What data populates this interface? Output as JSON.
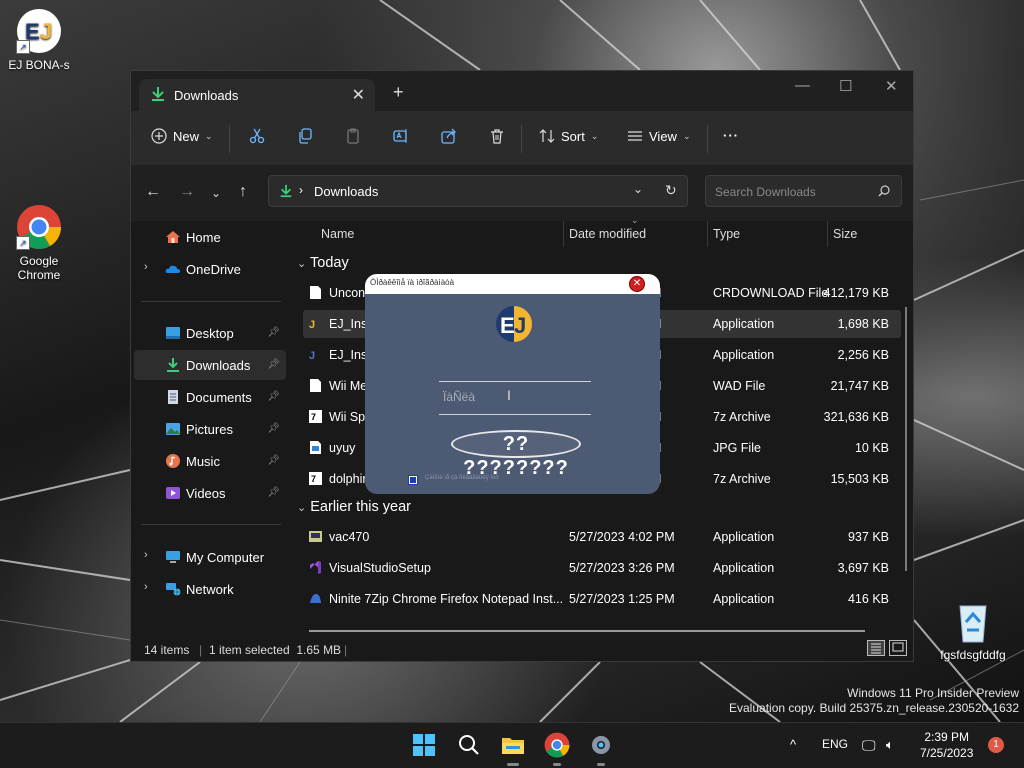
{
  "desktop": {
    "icons": [
      {
        "label": "EJ BONA-s"
      },
      {
        "label": "Google Chrome"
      },
      {
        "label": "fgsfdsgfddfg"
      }
    ]
  },
  "explorer": {
    "tab_title": "Downloads",
    "toolbar": {
      "new_label": "New",
      "sort_label": "Sort",
      "view_label": "View",
      "more_label": "···"
    },
    "breadcrumb": "Downloads",
    "search_placeholder": "Search Downloads",
    "sidebar": {
      "items": [
        {
          "label": "Home",
          "icon": "home-icon"
        },
        {
          "label": "OneDrive",
          "icon": "cloud-icon"
        },
        {
          "label": "Desktop",
          "icon": "desktop-icon"
        },
        {
          "label": "Downloads",
          "icon": "download-icon"
        },
        {
          "label": "Documents",
          "icon": "document-icon"
        },
        {
          "label": "Pictures",
          "icon": "picture-icon"
        },
        {
          "label": "Music",
          "icon": "music-icon"
        },
        {
          "label": "Videos",
          "icon": "video-icon"
        },
        {
          "label": "My Computer",
          "icon": "computer-icon"
        },
        {
          "label": "Network",
          "icon": "network-icon"
        }
      ]
    },
    "columns": {
      "name": "Name",
      "date": "Date modified",
      "type": "Type",
      "size": "Size"
    },
    "groups": {
      "today": "Today",
      "earlier": "Earlier this year"
    },
    "files_today": [
      {
        "name": "Uncon",
        "date": "M",
        "type": "CRDOWNLOAD File",
        "size": "412,179 KB"
      },
      {
        "name": "EJ_Insta",
        "date": "M",
        "type": "Application",
        "size": "1,698 KB"
      },
      {
        "name": "EJ_Insta",
        "date": "M",
        "type": "Application",
        "size": "2,256 KB"
      },
      {
        "name": "Wii Me",
        "date": "M",
        "type": "WAD File",
        "size": "21,747 KB"
      },
      {
        "name": "Wii Spo",
        "date": "M",
        "type": "7z Archive",
        "size": "321,636 KB"
      },
      {
        "name": "uyuy",
        "date": "M",
        "type": "JPG File",
        "size": "10 KB"
      },
      {
        "name": "dolphin",
        "date": "M",
        "type": "7z Archive",
        "size": "15,503 KB"
      }
    ],
    "files_earlier": [
      {
        "name": "vac470",
        "date": "5/27/2023 4:02 PM",
        "type": "Application",
        "size": "937 KB"
      },
      {
        "name": "VisualStudioSetup",
        "date": "5/27/2023 3:26 PM",
        "type": "Application",
        "size": "3,697 KB"
      },
      {
        "name": "Ninite 7Zip Chrome Firefox Notepad Inst...",
        "date": "5/27/2023 1:25 PM",
        "type": "Application",
        "size": "416 KB"
      }
    ],
    "status": {
      "items": "14 items",
      "selected": "1 item selected  1.65 MB"
    }
  },
  "dialog": {
    "title": "ÒÌðàêêîìå ïà ìðîãðàìàòà",
    "field_value": "ÏàÑëà",
    "button_label": "?? ????????",
    "checkbox_label": "Çàïîìíè ìå çà ñëåäâàùèÿ ïúò"
  },
  "watermark": {
    "line1": "Windows 11 Pro Insider Preview",
    "line2": "Evaluation copy. Build 25375.zn_release.230520-1632"
  },
  "taskbar": {
    "language": "ENG",
    "time": "2:39 PM",
    "date": "7/25/2023",
    "notifications": "1"
  },
  "colors": {
    "accent": "#4cc2ff",
    "dialog_bg": "#4d5a73",
    "ej_gold": "#f2b632",
    "ej_navy": "#1f3a6e"
  }
}
